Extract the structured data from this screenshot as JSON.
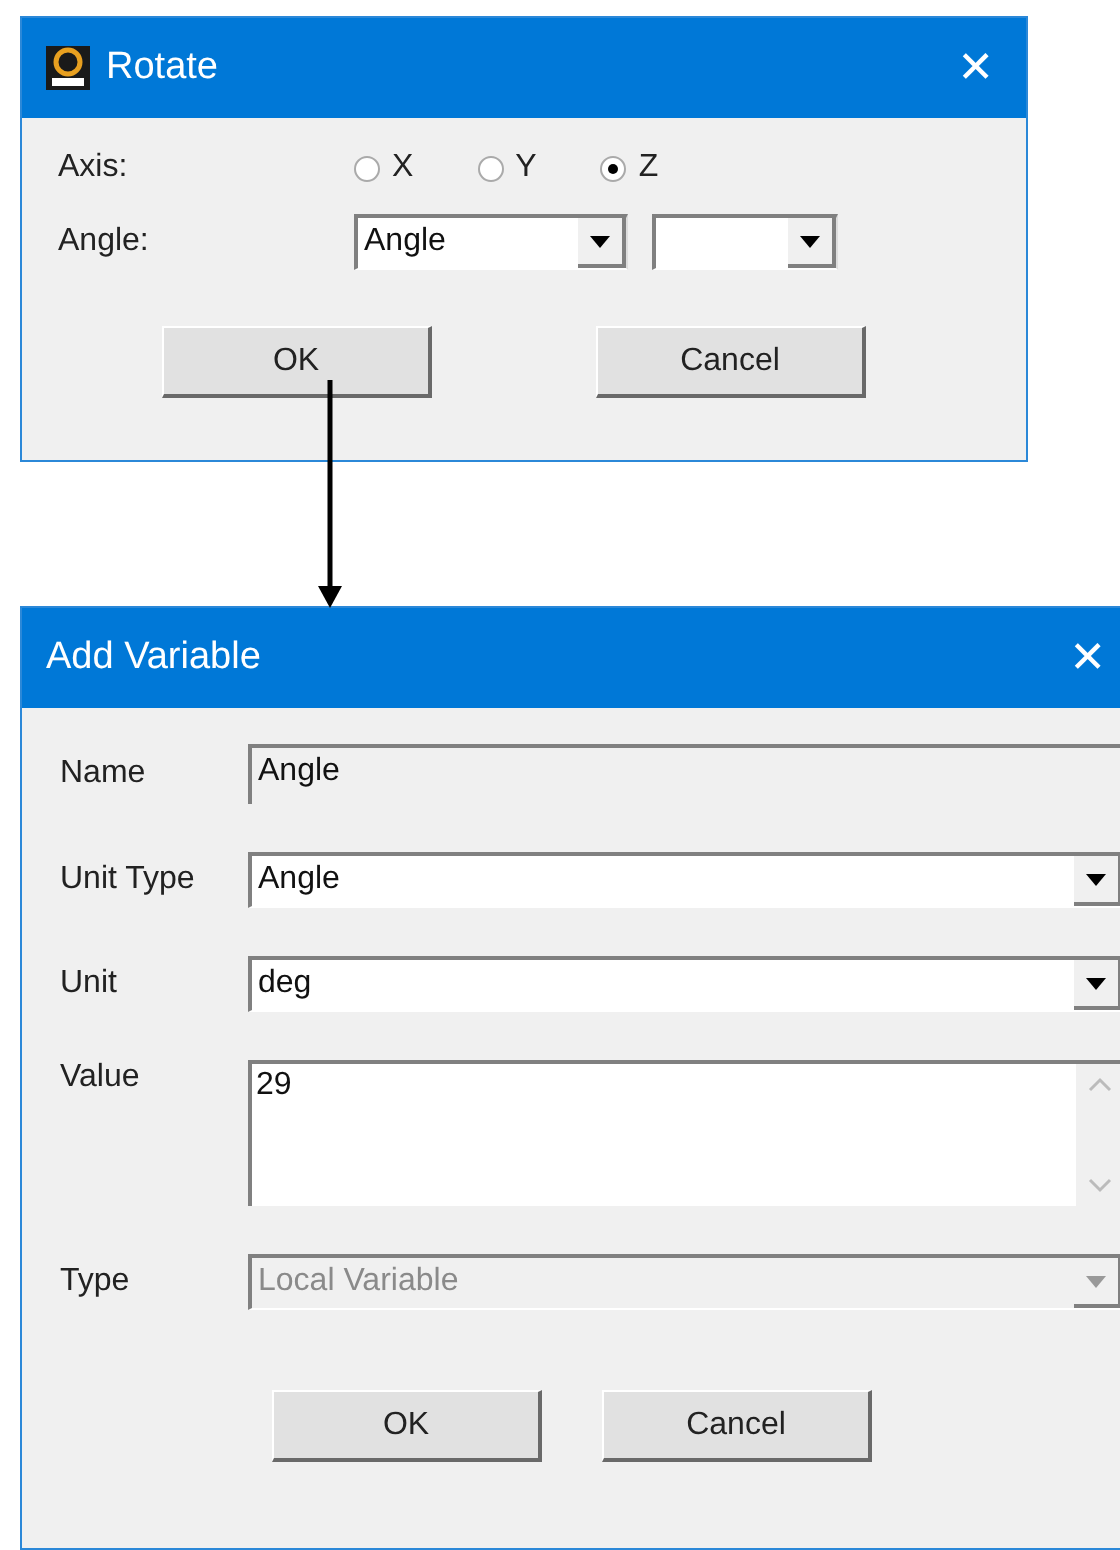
{
  "rotate_dialog": {
    "title": "Rotate",
    "close": "✕",
    "axis": {
      "label": "Axis:",
      "options": [
        {
          "label": "X",
          "selected": false
        },
        {
          "label": "Y",
          "selected": false
        },
        {
          "label": "Z",
          "selected": true
        }
      ]
    },
    "angle": {
      "label": "Angle:",
      "value": "Angle"
    },
    "buttons": [
      "OK",
      "Cancel"
    ]
  },
  "add_variable_dialog": {
    "title": "Add Variable",
    "close": "✕",
    "fields": [
      {
        "kind": "text",
        "label": "Name",
        "value": "Angle",
        "readonly": true,
        "disabled": false
      },
      {
        "kind": "combo",
        "label": "Unit Type",
        "value": "Angle",
        "readonly": false,
        "disabled": false
      },
      {
        "kind": "combo",
        "label": "Unit",
        "value": "deg",
        "readonly": false,
        "disabled": false
      },
      {
        "kind": "textarea",
        "label": "Value",
        "value": "29",
        "readonly": false,
        "disabled": false
      },
      {
        "kind": "combo",
        "label": "Type",
        "value": "Local Variable",
        "readonly": false,
        "disabled": true
      }
    ],
    "buttons": [
      "OK",
      "Cancel"
    ]
  }
}
